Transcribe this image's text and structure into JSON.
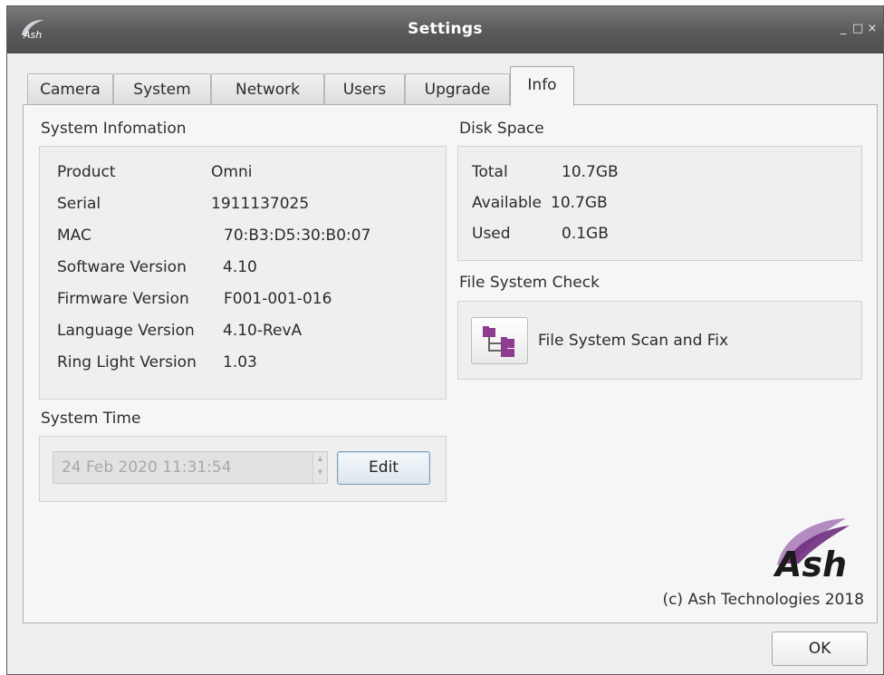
{
  "window": {
    "title": "Settings",
    "title_logo_text": "Ash",
    "controls": {
      "minimize": "_",
      "maximize": "□",
      "close": "×"
    }
  },
  "tabs": [
    {
      "label": "Camera",
      "active": false
    },
    {
      "label": "System",
      "active": false
    },
    {
      "label": "Network",
      "active": false
    },
    {
      "label": "Users",
      "active": false
    },
    {
      "label": "Upgrade",
      "active": false
    },
    {
      "label": "Info",
      "active": true
    }
  ],
  "system_info": {
    "title": "System Infomation",
    "rows": [
      {
        "label": "Product",
        "value": "Omni"
      },
      {
        "label": "Serial",
        "value": "1911137025"
      },
      {
        "label": "MAC",
        "value": "70:B3:D5:30:B0:07"
      },
      {
        "label": "Software Version",
        "value": "4.10"
      },
      {
        "label": "Firmware Version",
        "value": "F001-001-016"
      },
      {
        "label": "Language Version",
        "value": "4.10-RevA"
      },
      {
        "label": "Ring Light Version",
        "value": "1.03"
      }
    ]
  },
  "system_time": {
    "title": "System Time",
    "value": "24 Feb 2020 11:31:54",
    "edit_label": "Edit"
  },
  "disk_space": {
    "title": "Disk Space",
    "rows": [
      {
        "label": "Total",
        "value": "10.7GB"
      },
      {
        "label": "Available",
        "value": "10.7GB"
      },
      {
        "label": "Used",
        "value": "0.1GB"
      }
    ]
  },
  "file_system_check": {
    "title": "File System Check",
    "button_label": "File System Scan and Fix",
    "icon": "folder-tree-icon"
  },
  "branding": {
    "logo_text": "Ash",
    "copyright": "(c) Ash Technologies 2018"
  },
  "footer": {
    "ok_label": "OK"
  },
  "colors": {
    "titlebar": "#595959",
    "panel": "#f6f6f6",
    "logo_purple": "#7b3f8f",
    "icon_purple": "#8e3c8f"
  }
}
